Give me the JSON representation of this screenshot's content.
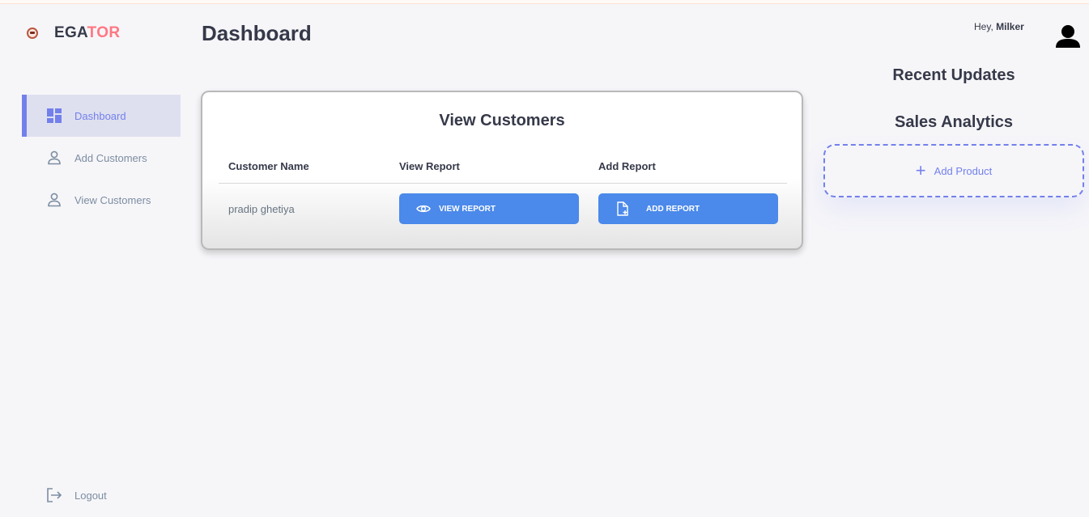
{
  "brand": {
    "name_main": "EGA",
    "name_accent": "TOR"
  },
  "sidebar": {
    "items": [
      {
        "label": "Dashboard",
        "icon": "grid-dashboard-icon",
        "active": true
      },
      {
        "label": "Add Customers",
        "icon": "person-outline-icon",
        "active": false
      },
      {
        "label": "View Customers",
        "icon": "person-outline-icon",
        "active": false
      }
    ],
    "logout_label": "Logout"
  },
  "header": {
    "title": "Dashboard"
  },
  "customers_card": {
    "title": "View Customers",
    "columns": [
      "Customer Name",
      "View Report",
      "Add Report"
    ],
    "rows": [
      {
        "name": "pradip ghetiya",
        "view_button": "VIEW REPORT",
        "add_button": "ADD REPORT"
      }
    ]
  },
  "profile": {
    "greeting": "Hey,",
    "username": "Milker"
  },
  "right_panel": {
    "recent_updates_title": "Recent Updates",
    "sales_analytics_title": "Sales Analytics",
    "add_product_label": "Add Product"
  },
  "colors": {
    "primary": "#7380ec",
    "accent": "#ff7782",
    "button": "#4b89ea",
    "background": "#f6f6f9",
    "text_dark": "#363949",
    "text_muted": "#7d8da1"
  }
}
